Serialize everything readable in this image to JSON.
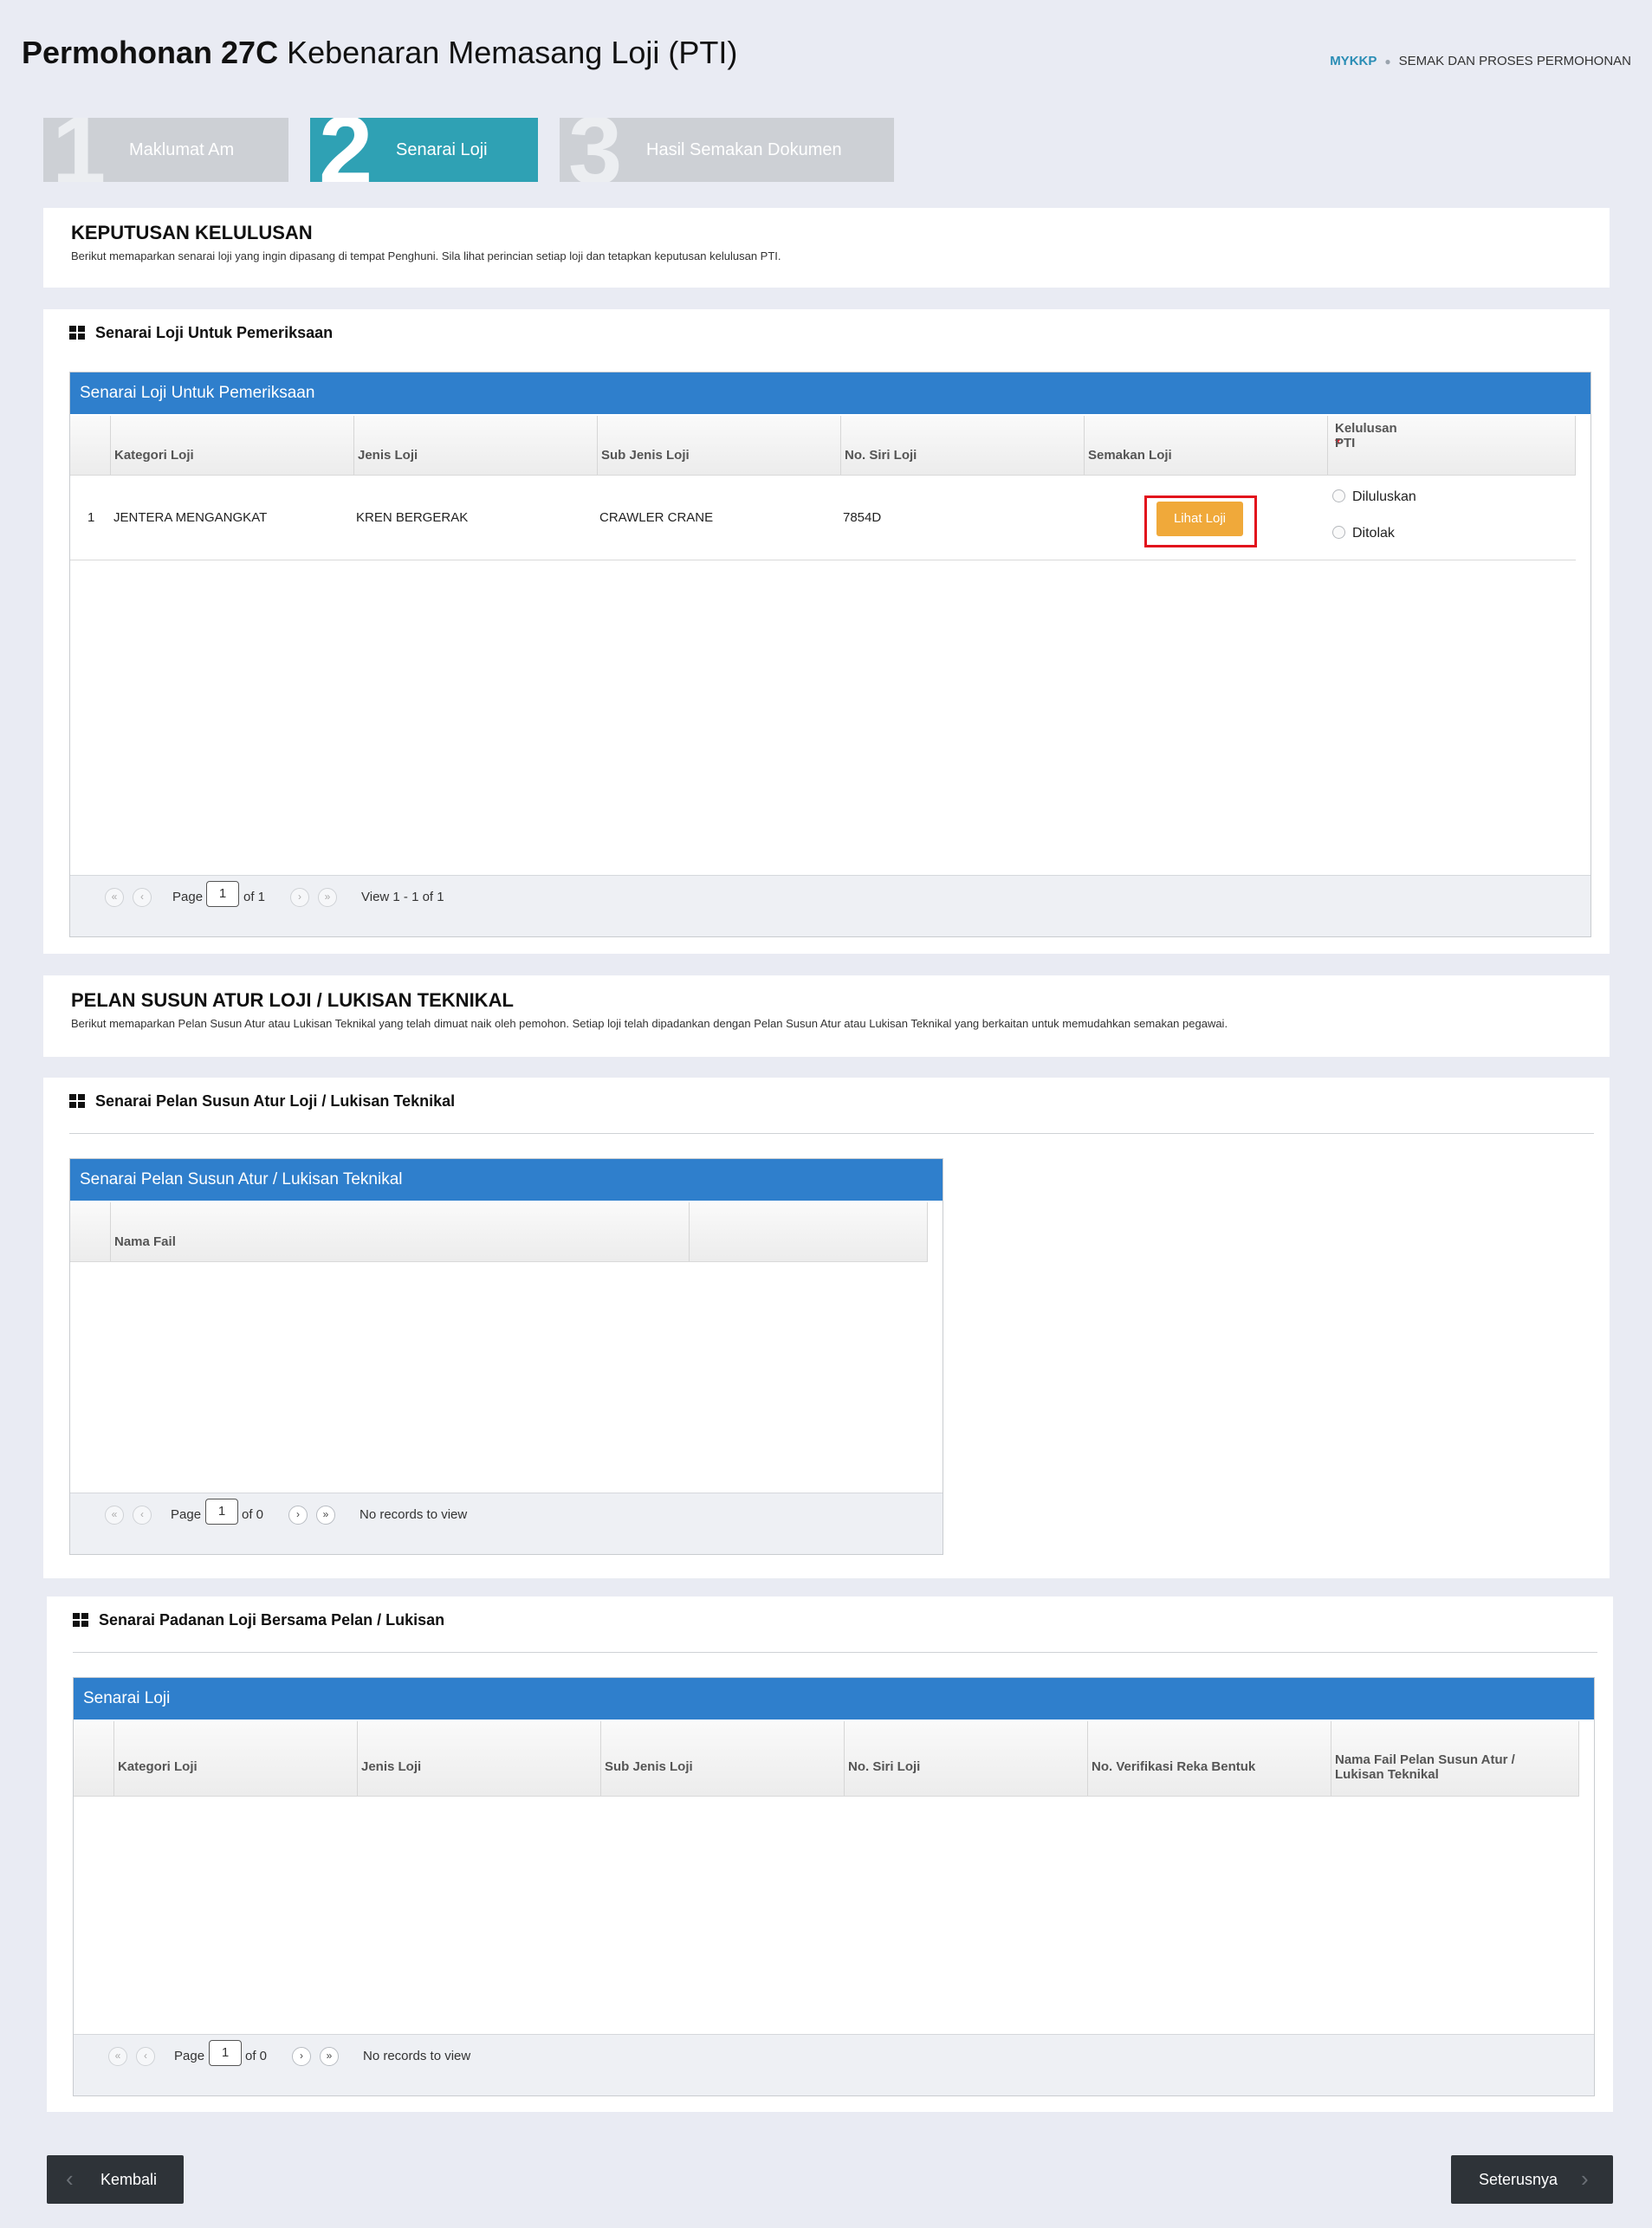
{
  "header": {
    "title_bold": "Permohonan 27C",
    "title_rest": "Kebenaran Memasang Loji (PTI)",
    "breadcrumb": {
      "home": "MYKKP",
      "separator": "●",
      "current": "SEMAK DAN PROSES PERMOHONAN"
    }
  },
  "steps": [
    {
      "number": "1",
      "label": "Maklumat Am",
      "state": "inactive"
    },
    {
      "number": "2",
      "label": "Senarai Loji",
      "state": "active"
    },
    {
      "number": "3",
      "label": "Hasil Semakan Dokumen",
      "state": "inactive"
    }
  ],
  "keputusan": {
    "title": "KEPUTUSAN KELULUSAN",
    "description": "Berikut memaparkan senarai loji yang ingin dipasang di tempat Penghuni. Sila lihat perincian setiap loji dan tetapkan keputusan kelulusan PTI."
  },
  "senarai_loji_section": {
    "heading": "Senarai Loji Untuk Pemeriksaan",
    "grid_caption": "Senarai Loji Untuk Pemeriksaan",
    "columns": [
      "Kategori Loji",
      "Jenis Loji",
      "Sub Jenis Loji",
      "No. Siri Loji",
      "Semakan Loji",
      "Kelulusan PTI"
    ],
    "required_mark": "*",
    "rows": [
      {
        "index": "1",
        "kategori": "JENTERA MENGANGKAT",
        "jenis": "KREN BERGERAK",
        "sub_jenis": "CRAWLER CRANE",
        "no_siri": "7854D",
        "button": "Lihat Loji",
        "radio_options": [
          "Diluluskan",
          "Ditolak"
        ]
      }
    ],
    "pager": {
      "page_label": "Page",
      "page_value": "1",
      "of_text": "of 1",
      "view_text": "View 1 - 1 of 1"
    }
  },
  "pelan": {
    "title": "PELAN SUSUN ATUR LOJI / LUKISAN TEKNIKAL",
    "description": "Berikut memaparkan Pelan Susun Atur atau Lukisan Teknikal yang telah dimuat naik oleh pemohon. Setiap loji telah dipadankan dengan Pelan Susun Atur atau Lukisan Teknikal yang berkaitan untuk memudahkan semakan pegawai."
  },
  "pelan_list_section": {
    "heading": "Senarai Pelan Susun Atur Loji / Lukisan Teknikal",
    "grid_caption": "Senarai Pelan Susun Atur / Lukisan Teknikal",
    "columns": [
      "Nama Fail",
      ""
    ],
    "pager": {
      "page_label": "Page",
      "page_value": "1",
      "of_text": "of 0",
      "view_text": "No records to view"
    }
  },
  "padanan_section": {
    "heading": "Senarai Padanan Loji Bersama Pelan / Lukisan",
    "grid_caption": "Senarai Loji",
    "columns": [
      "Kategori Loji",
      "Jenis Loji",
      "Sub Jenis Loji",
      "No. Siri Loji",
      "No. Verifikasi Reka Bentuk",
      "Nama Fail Pelan Susun Atur / Lukisan Teknikal"
    ],
    "pager": {
      "page_label": "Page",
      "page_value": "1",
      "of_text": "of 0",
      "view_text": "No records to view"
    }
  },
  "buttons": {
    "back": "Kembali",
    "next": "Seterusnya"
  },
  "icons": {
    "back": "chevron-left-icon",
    "next": "chevron-right-icon",
    "section": "grid-icon"
  },
  "colors": {
    "accent_blue": "#2f7fcc",
    "active_step": "#2fa1b4",
    "button_orange": "#f0a93a",
    "highlight_red": "#e2121c"
  }
}
